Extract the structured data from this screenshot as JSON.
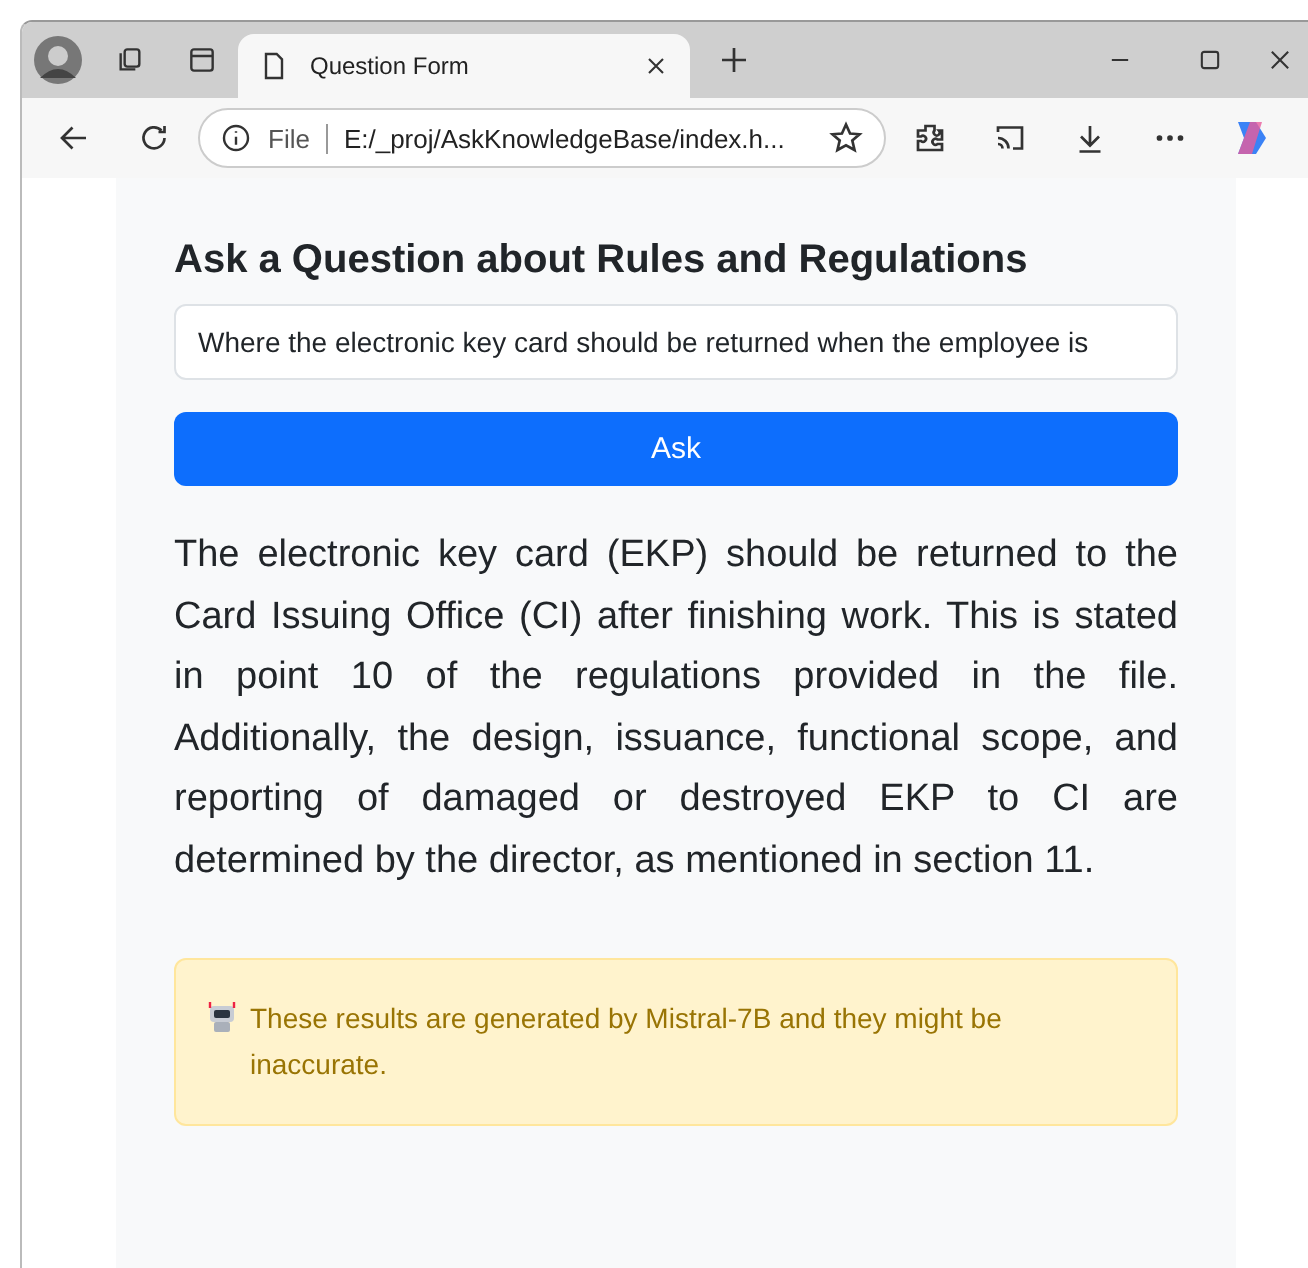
{
  "browser": {
    "tab_title": "Question Form",
    "address_scheme": "File",
    "address": "E:/_proj/AskKnowledgeBase/index.h..."
  },
  "form": {
    "heading": "Ask a Question about Rules and Regulations",
    "question": "Where the electronic key card should be returned when the employee is",
    "button": "Ask"
  },
  "answer": "The electronic key card (EKP) should be returned to the Card Issuing Office (CI) after finishing work. This is stated in point 10 of the regulations provided in the file. Additionally, the design, issuance, functional scope, and reporting of damaged or destroyed EKP to CI are determined by the director, as mentioned in section 11.",
  "notice": {
    "text": "These results are generated by Mistral-7B and they might be inaccurate."
  }
}
